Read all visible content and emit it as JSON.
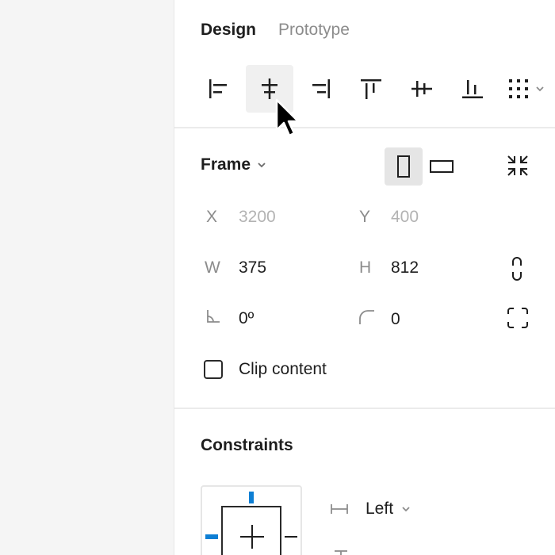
{
  "tabs": {
    "design": "Design",
    "prototype": "Prototype"
  },
  "align_tools": [
    {
      "name": "align-left-icon"
    },
    {
      "name": "align-horizontal-center-icon",
      "hover": true
    },
    {
      "name": "align-right-icon"
    },
    {
      "name": "align-top-icon"
    },
    {
      "name": "align-vertical-center-icon"
    },
    {
      "name": "align-bottom-icon"
    },
    {
      "name": "distribute-grid-icon"
    }
  ],
  "frame": {
    "label": "Frame",
    "x_label": "X",
    "x_value": "3200",
    "y_label": "Y",
    "y_value": "400",
    "w_label": "W",
    "w_value": "375",
    "h_label": "H",
    "h_value": "812",
    "rotation_value": "0º",
    "radius_value": "0",
    "clip_label": "Clip content",
    "clip_checked": false
  },
  "constraints": {
    "title": "Constraints",
    "horizontal_value": "Left"
  },
  "colors": {
    "accent": "#0d7fd4",
    "panel_bg": "#ffffff",
    "canvas_bg": "#f5f5f5"
  }
}
